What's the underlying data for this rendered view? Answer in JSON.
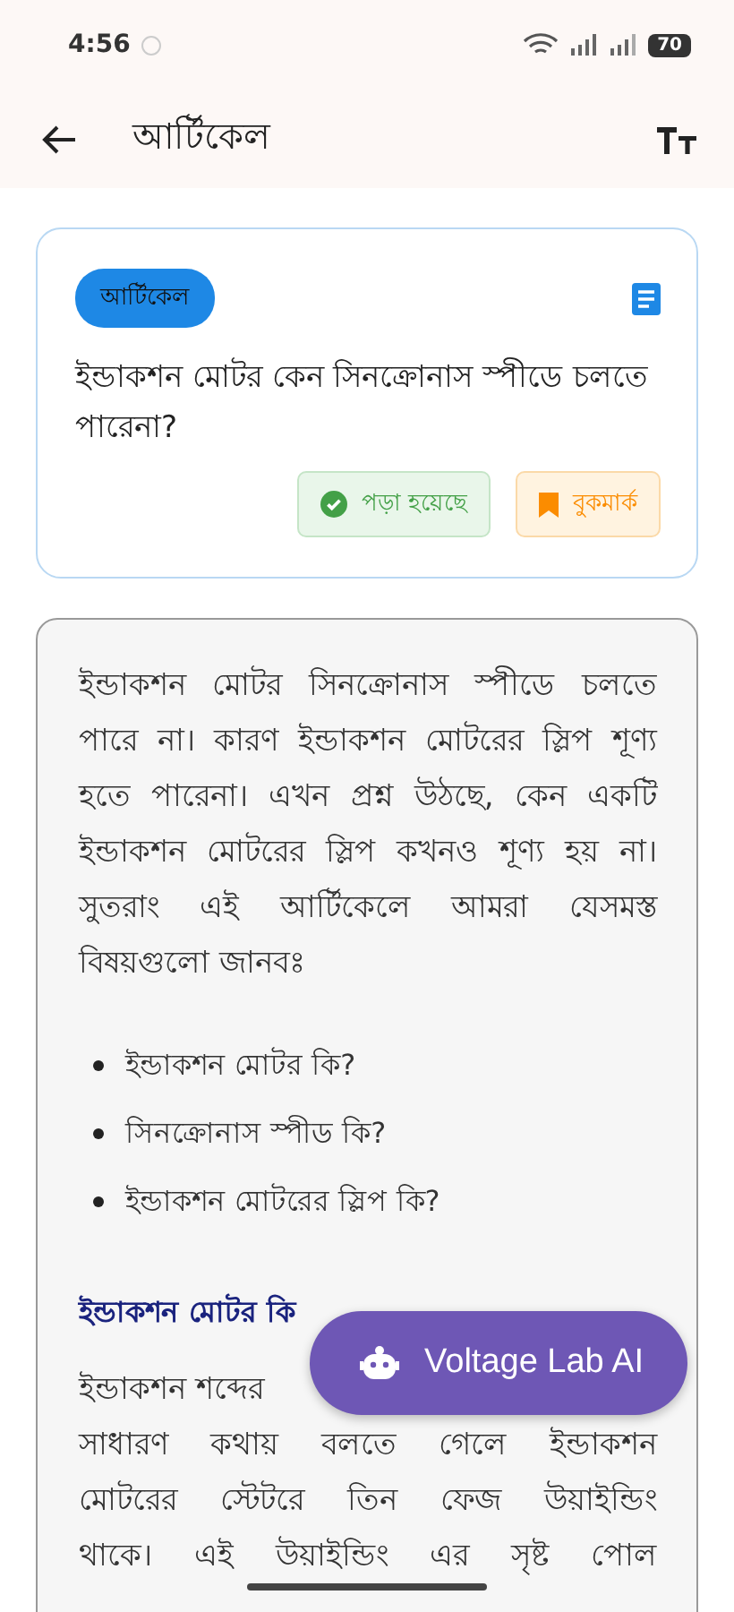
{
  "status_bar": {
    "time": "4:56",
    "battery": "70"
  },
  "app_bar": {
    "title": "আর্টিকেল"
  },
  "header_card": {
    "tag": "আর্টিকেল",
    "title": "ইন্ডাকশন মোটর কেন সিনক্রোনাস স্পীডে চলতে পারেনা?",
    "actions": [
      {
        "kind": "read",
        "label": "পড়া হয়েছে"
      },
      {
        "kind": "bookmark",
        "label": "বুকমার্ক"
      }
    ]
  },
  "article": {
    "intro": "ইন্ডাকশন মোটর সিনক্রোনাস স্পীডে চলতে পারে না। কারণ ইন্ডাকশন মোটরের স্লিপ শূণ্য হতে পারেনা। এখন প্রশ্ন উঠছে, কেন একটি ইন্ডাকশন মোটরের স্লিপ কখনও শূণ্য হয় না। সুতরাং এই আর্টিকেলে আমরা যেসমস্ত বিষয়গুলো জানবঃ",
    "bullets": [
      "ইন্ডাকশন মোটর কি?",
      "সিনক্রোনাস স্পীড কি?",
      "ইন্ডাকশন মোটরের স্লিপ কি?"
    ],
    "heading": "ইন্ডাকশন মোটর কি",
    "paragraph_lines": [
      "ইন্ডাকশন শব্দের",
      "সাধারণ কথায় বলতে গেলে ইন্ডাকশন",
      "মোটরের স্টেটরে তিন ফেজ উয়াইন্ডিং",
      "থাকে। এই উয়াইন্ডিং এর সৃষ্ট পোল"
    ]
  },
  "fab": {
    "label": "Voltage Lab AI"
  }
}
